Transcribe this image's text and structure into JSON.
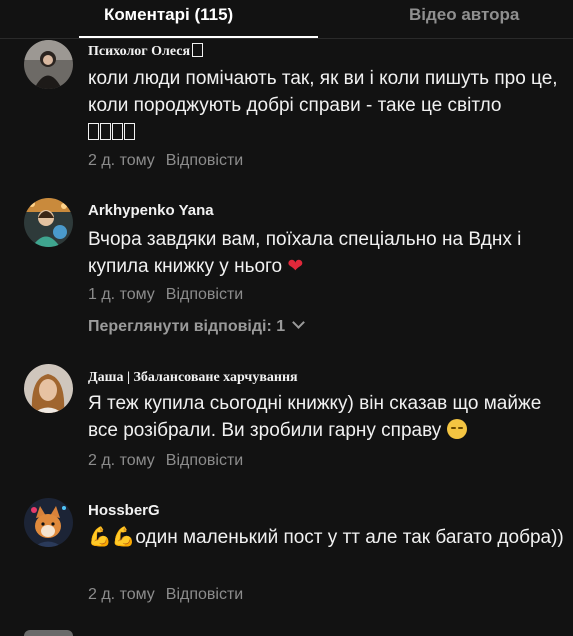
{
  "tabs": {
    "comments_label": "Коментарі (115)",
    "author_videos_label": "Відео автора"
  },
  "reply_label": "Відповісти",
  "comments": [
    {
      "author": "Психолог Олеся",
      "text": "коли люди помічають так, як ви і коли пишуть про це, коли породжують добрі справи - таке це світло",
      "time": "2 д. тому"
    },
    {
      "author": "Arkhypenko Yana",
      "text": "Вчора завдяки вам, поїхала спеціально на Вднх і купила книжку у нього",
      "time": "1 д. тому",
      "view_replies": "Переглянути відповіді: 1"
    },
    {
      "author": "Даша | Збалансоване харчування",
      "text": "Я теж купила сьогодні книжку) він сказав що майже все розібрали. Ви зробили гарну справу",
      "time": "2 д. тому"
    },
    {
      "author": "HossberG",
      "text": "один маленький пост у тт але так багато добра))",
      "time": "2 д. тому"
    }
  ]
}
